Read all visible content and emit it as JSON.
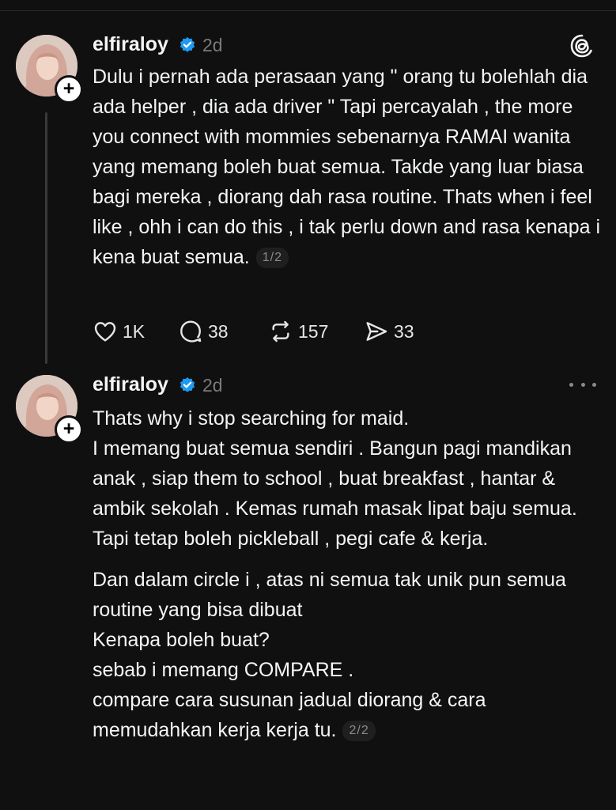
{
  "colors": {
    "background": "#101010",
    "text": "#f3f5f7",
    "muted": "#7a7a7a",
    "verified": "#1d9bf0"
  },
  "posts": [
    {
      "username": "elfiraloy",
      "time": "2d",
      "text": "Dulu i pernah ada perasaan yang \" orang tu bolehlah dia ada helper , dia ada driver \" Tapi percayalah , the more you connect with mommies sebenarnya RAMAI wanita yang memang boleh buat semua. Takde yang luar biasa bagi mereka , diorang dah rasa routine. Thats when i feel like , ohh i can do this , i tak perlu down and rasa kenapa i kena buat semua.",
      "page": "1/2",
      "likes": "1K",
      "replies": "38",
      "reposts": "157",
      "shares": "33",
      "corner_icon": "threads-logo-icon"
    },
    {
      "username": "elfiraloy",
      "time": "2d",
      "paragraph1": "Thats why i stop searching for maid.\nI memang buat semua sendiri . Bangun pagi mandikan anak , siap them to school , buat breakfast , hantar & ambik sekolah . Kemas rumah masak lipat baju semua. Tapi tetap boleh pickleball , pegi cafe & kerja.",
      "paragraph2": "Dan dalam circle i , atas ni semua tak unik pun semua routine yang bisa dibuat\nKenapa boleh buat?\nsebab i memang COMPARE .\ncompare cara susunan jadual diorang & cara memudahkan kerja kerja tu.",
      "page": "2/2",
      "corner_icon": "more-options-icon"
    }
  ]
}
